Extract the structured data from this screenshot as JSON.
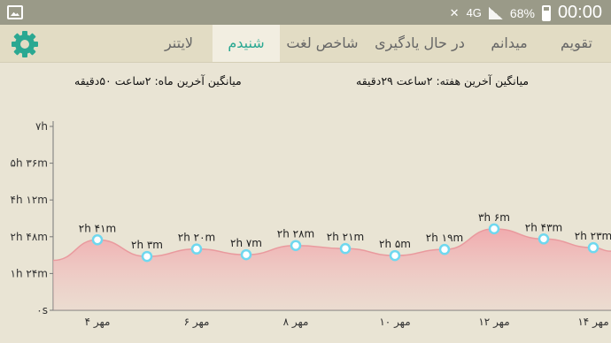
{
  "status_bar": {
    "network": "4G",
    "battery_percent": "68%",
    "time": "00:00"
  },
  "tabs": [
    {
      "label": "تقویم",
      "active": false
    },
    {
      "label": "میدانم",
      "active": false
    },
    {
      "label": "در حال یادگیری",
      "active": false
    },
    {
      "label": "شاخص لغت",
      "active": false
    },
    {
      "label": "شنیدم",
      "active": true
    },
    {
      "label": "لایتنر",
      "active": false
    }
  ],
  "summary": {
    "week_average": "میانگین آخرین هفته: ۲ساعت  ۲۹دقیقه",
    "month_average": "میانگین آخرین ماه: ۲ساعت  ۵۰دقیقه"
  },
  "colors": {
    "accent": "#2aa892",
    "area_fill": "#f3b6b8",
    "line": "#e99a9e",
    "point": "#6fd8ef"
  },
  "chart_data": {
    "type": "area",
    "y_ticks": [
      {
        "label": "۰s",
        "value": 0
      },
      {
        "label": "۱h ۲۴m",
        "value": 84
      },
      {
        "label": "۲h ۴۸m",
        "value": 168
      },
      {
        "label": "۴h ۱۲m",
        "value": 252
      },
      {
        "label": "۵h ۳۶m",
        "value": 336
      },
      {
        "label": "۷h",
        "value": 420
      }
    ],
    "ylim": [
      0,
      420
    ],
    "x_ticks": [
      {
        "label": "۴ مهر",
        "day": 4
      },
      {
        "label": "۶ مهر",
        "day": 6
      },
      {
        "label": "۸ مهر",
        "day": 8
      },
      {
        "label": "۱۰ مهر",
        "day": 10
      },
      {
        "label": "۱۲ مهر",
        "day": 12
      },
      {
        "label": "۱۴ مهر",
        "day": 14
      }
    ],
    "xlim": [
      3,
      14
    ],
    "points": [
      {
        "day": 4,
        "value": 161,
        "label": "۲h ۴۱m"
      },
      {
        "day": 5,
        "value": 123,
        "label": "۲h ۳m"
      },
      {
        "day": 6,
        "value": 140,
        "label": "۲h ۲۰m"
      },
      {
        "day": 7,
        "value": 127,
        "label": "۲h ۷m"
      },
      {
        "day": 8,
        "value": 148,
        "label": "۲h ۲۸m"
      },
      {
        "day": 9,
        "value": 141,
        "label": "۲h ۲۱m"
      },
      {
        "day": 10,
        "value": 125,
        "label": "۲h ۵m"
      },
      {
        "day": 11,
        "value": 139,
        "label": "۲h ۱۹m"
      },
      {
        "day": 12,
        "value": 186,
        "label": "۳h ۶m"
      },
      {
        "day": 13,
        "value": 163,
        "label": "۲h ۴۳m"
      },
      {
        "day": 14,
        "value": 143,
        "label": "۲h ۲۳m"
      }
    ],
    "start_value": 114,
    "grid": false
  }
}
